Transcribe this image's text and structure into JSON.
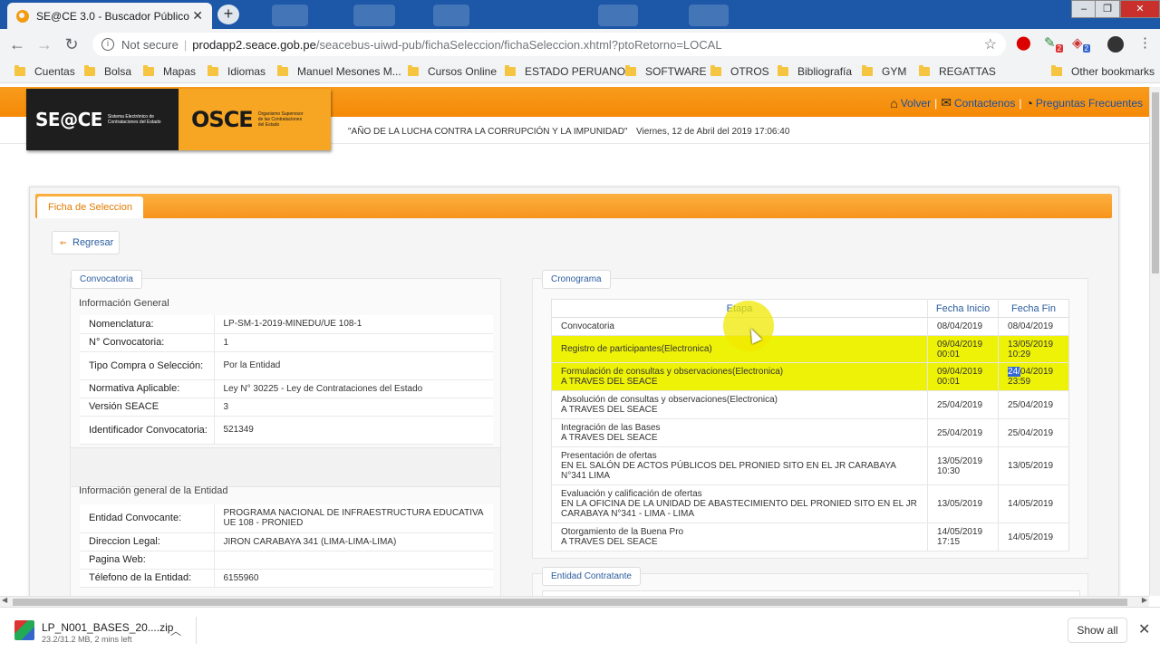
{
  "browser": {
    "tab_title": "SE@CE 3.0 - Buscador Público",
    "tab_close": "✕",
    "new_tab": "+",
    "url_security": "Not secure",
    "url_separator": "|",
    "url_host": "prodapp2.seace.gob.pe",
    "url_path": "/seacebus-uiwd-pub/fichaSeleccion/fichaSeleccion.xhtml?ptoRetorno=LOCAL",
    "bookmarks": [
      "Cuentas",
      "Bolsa",
      "Mapas",
      "Idiomas",
      "Manuel Mesones M...",
      "Cursos Online",
      "ESTADO PERUANO",
      "SOFTWARE",
      "OTROS",
      "Bibliografía",
      "GYM",
      "REGATTAS"
    ],
    "other_bookmarks": "Other bookmarks",
    "ext_badges": [
      "2",
      "2"
    ]
  },
  "header": {
    "logo_seace": "SE@CE",
    "logo_seace_sub": "Sistema Electrónico de Contrataciones del Estado",
    "logo_osce": "OSCE",
    "logo_osce_sub": "Organismo Supervisor de las Contrataciones del Estado",
    "links": {
      "volver": "Volver",
      "contactenos": "Contactenos",
      "preguntas": "Preguntas Frecuentes",
      "sep": "|"
    },
    "motto": "\"AÑO DE LA LUCHA CONTRA LA CORRUPCIÓN Y LA IMPUNIDAD\"",
    "date": "Viernes, 12 de Abril del 2019  17:06:40"
  },
  "main": {
    "tab": "Ficha de Seleccion",
    "back_button": "Regresar",
    "convocatoria": {
      "legend": "Convocatoria",
      "section1_title": "Información General",
      "general": [
        {
          "label": "Nomenclatura:",
          "value": "LP-SM-1-2019-MINEDU/UE 108-1"
        },
        {
          "label": "N° Convocatoria:",
          "value": "1"
        },
        {
          "label": "Tipo Compra o Selección:",
          "value": "Por la Entidad"
        },
        {
          "label": "Normativa Aplicable:",
          "value": "Ley N° 30225 - Ley de Contrataciones del Estado"
        },
        {
          "label": "Versión SEACE",
          "value": "3"
        },
        {
          "label": "Identificador Convocatoria:",
          "value": "521349"
        }
      ],
      "section2_title": "Información general de la Entidad",
      "entidad": [
        {
          "label": "Entidad Convocante:",
          "value": "PROGRAMA NACIONAL DE INFRAESTRUCTURA EDUCATIVA UE 108 - PRONIED"
        },
        {
          "label": "Direccion Legal:",
          "value": "JIRON CARABAYA 341 (LIMA-LIMA-LIMA)"
        },
        {
          "label": "Pagina Web:",
          "value": ""
        },
        {
          "label": "Télefono de la Entidad:",
          "value": "6155960"
        }
      ]
    },
    "cronograma": {
      "legend": "Cronograma",
      "headers": [
        "Etapa",
        "Fecha Inicio",
        "Fecha Fin"
      ],
      "rows": [
        {
          "etapa": "Convocatoria",
          "lugar": "",
          "inicio": "08/04/2019",
          "fin": "08/04/2019",
          "highlight": false
        },
        {
          "etapa": "Registro de participantes(Electronica)",
          "lugar": "",
          "inicio": "09/04/2019 00:01",
          "fin": "13/05/2019 10:29",
          "highlight": true
        },
        {
          "etapa": "Formulación de consultas y observaciones(Electronica)",
          "lugar": "A TRAVES DEL SEACE",
          "inicio": "09/04/2019 00:01",
          "fin_sel": "24/",
          "fin_rest": "04/2019",
          "fin_time": "23:59",
          "highlight": true
        },
        {
          "etapa": "Absolución de consultas y observaciones(Electronica)",
          "lugar": "A TRAVES DEL SEACE",
          "inicio": "25/04/2019",
          "fin": "25/04/2019",
          "highlight": false
        },
        {
          "etapa": "Integración de las Bases",
          "lugar": "A TRAVES DEL SEACE",
          "inicio": "25/04/2019",
          "fin": "25/04/2019",
          "highlight": false
        },
        {
          "etapa": "Presentación de ofertas",
          "lugar": "EN EL SALÓN DE ACTOS PÚBLICOS DEL PRONIED SITO EN EL JR CARABAYA N°341 LIMA",
          "inicio": "13/05/2019 10:30",
          "fin": "13/05/2019",
          "highlight": false
        },
        {
          "etapa": "Evaluación y calificación de ofertas",
          "lugar": "EN LA OFICINA DE LA UNIDAD DE ABASTECIMIENTO DEL PRONIED SITO EN EL JR CARABAYA N°341 - LIMA - LIMA",
          "inicio": "13/05/2019",
          "fin": "14/05/2019",
          "highlight": false
        },
        {
          "etapa": "Otorgamiento de la Buena Pro",
          "lugar": "A TRAVES DEL SEACE",
          "inicio": "14/05/2019 17:15",
          "fin": "14/05/2019",
          "highlight": false
        }
      ]
    },
    "entidad_contratante": {
      "legend": "Entidad Contratante"
    }
  },
  "download": {
    "filename": "LP_N001_BASES_20....zip",
    "status": "23.2/31.2 MB, 2 mins left",
    "show_all": "Show all"
  }
}
